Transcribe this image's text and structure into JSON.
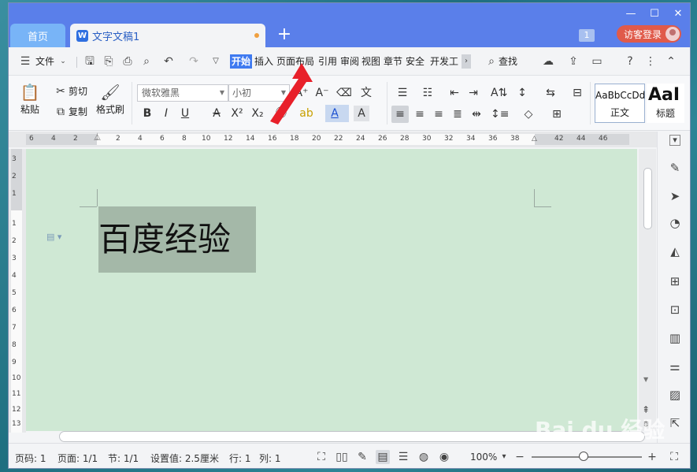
{
  "titlebar": {
    "home_tab": "首页",
    "doc_tab": "文字文稿1",
    "doc_icon": "W",
    "add_tab": "+",
    "count_badge": "1",
    "login": "访客登录",
    "minimize": "—",
    "maximize": "☐",
    "close": "✕"
  },
  "menu": {
    "file": "文件",
    "items": [
      "开始",
      "插入",
      "页面布局",
      "引用",
      "审阅",
      "视图",
      "章节",
      "安全",
      "开发工"
    ],
    "search": "查找",
    "more": "›"
  },
  "ribbon": {
    "paste": "粘贴",
    "cut": "剪切",
    "copy": "复制",
    "format_painter": "格式刷",
    "font_name": "微软雅黑",
    "font_size": "小初",
    "style_normal_sample": "AaBbCcDd",
    "style_normal": "正文",
    "style_heading_sample": "AaI",
    "style_heading": "标题"
  },
  "ruler": {
    "h_numbers": [
      "6",
      "4",
      "2",
      "2",
      "4",
      "6",
      "8",
      "10",
      "12",
      "14",
      "16",
      "18",
      "20",
      "22",
      "24",
      "26",
      "28",
      "30",
      "32",
      "34",
      "36",
      "38",
      "42",
      "44",
      "46"
    ],
    "v_numbers": [
      "3",
      "2",
      "1",
      "1",
      "2",
      "3",
      "4",
      "5",
      "6",
      "7",
      "8",
      "9",
      "10",
      "11",
      "12",
      "13"
    ]
  },
  "document": {
    "heading": "百度经验"
  },
  "statusbar": {
    "page_num": "页码: 1",
    "pages": "页面: 1/1",
    "section": "节: 1/1",
    "position": "设置值: 2.5厘米",
    "line": "行: 1",
    "column": "列: 1",
    "zoom": "100%"
  },
  "watermark": "Bai du 经验",
  "colors": {
    "titlebar": "#5a7fea",
    "accent": "#3f7af0",
    "canvas": "#cfe8d4",
    "login_button": "#e05a4a",
    "arrow": "#e8202a"
  }
}
